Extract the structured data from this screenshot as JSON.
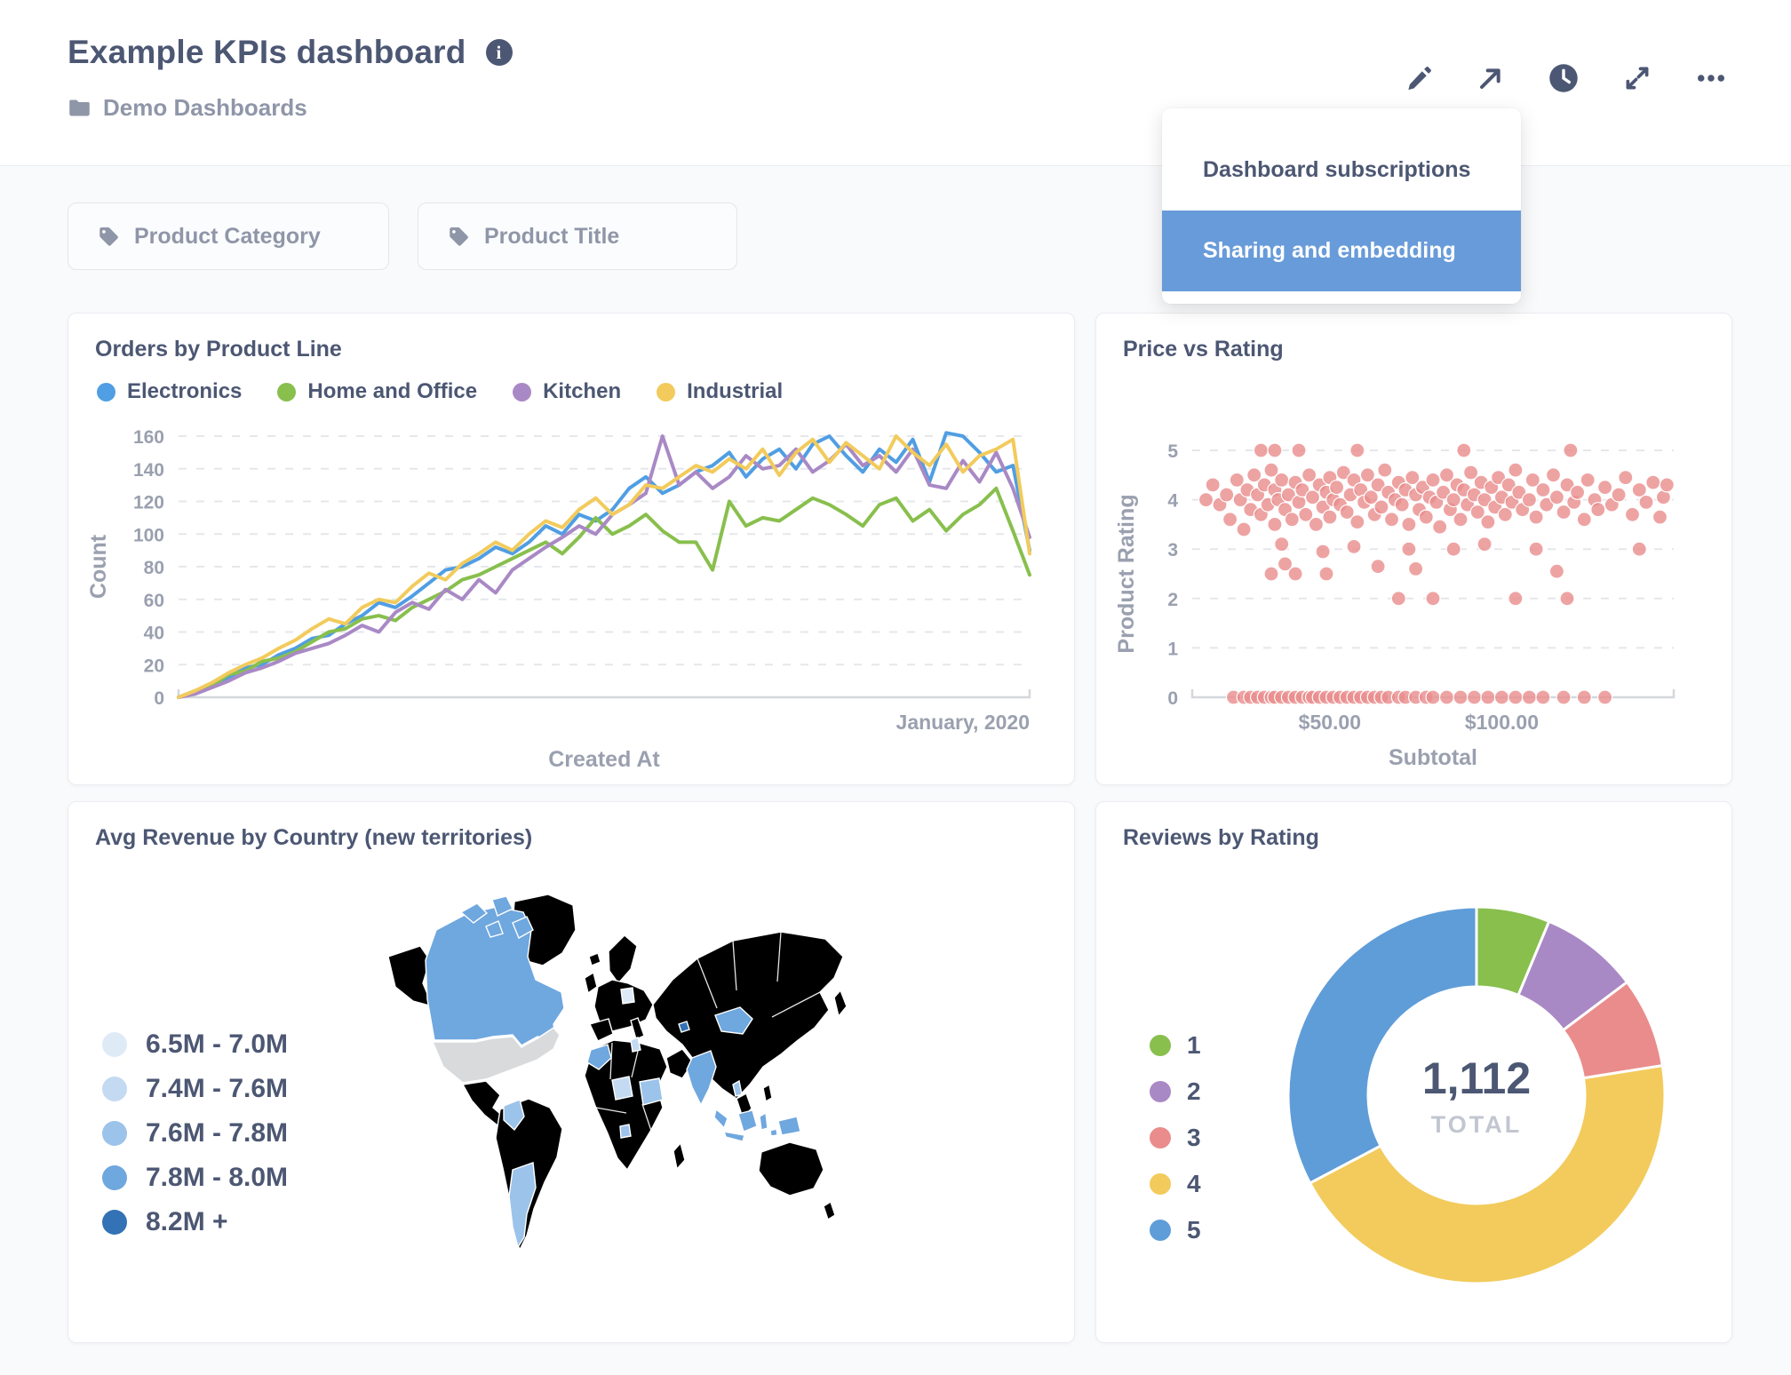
{
  "header": {
    "title": "Example KPIs dashboard",
    "breadcrumb": "Demo Dashboards"
  },
  "menu": {
    "active_bg": "#689BD9",
    "items": [
      {
        "label": "Dashboard subscriptions",
        "active": false
      },
      {
        "label": "Sharing and embedding",
        "active": true
      }
    ]
  },
  "filters": [
    {
      "label": "Product Category"
    },
    {
      "label": "Product Title"
    }
  ],
  "chart_data": [
    {
      "type": "line",
      "title": "Orders by Product Line",
      "xlabel": "Created At",
      "ylabel": "Count",
      "x_end_label": "January, 2020",
      "ylim": [
        0,
        160
      ],
      "yticks": [
        0,
        20,
        40,
        60,
        80,
        100,
        120,
        140,
        160
      ],
      "grid": "dashed-horizontal",
      "legend_position": "top",
      "series": [
        {
          "name": "Electronics",
          "color": "#509EE3",
          "values": [
            0,
            3,
            8,
            12,
            18,
            20,
            26,
            30,
            36,
            38,
            45,
            50,
            58,
            55,
            62,
            70,
            78,
            80,
            85,
            92,
            88,
            95,
            105,
            100,
            112,
            108,
            115,
            128,
            135,
            125,
            130,
            138,
            142,
            150,
            135,
            146,
            152,
            140,
            155,
            160,
            148,
            138,
            152,
            144,
            158,
            132,
            162,
            160,
            150,
            138,
            142,
            90
          ]
        },
        {
          "name": "Home and Office",
          "color": "#88BF4D",
          "values": [
            0,
            4,
            7,
            14,
            16,
            22,
            24,
            28,
            34,
            40,
            42,
            48,
            50,
            47,
            55,
            60,
            65,
            72,
            75,
            80,
            85,
            90,
            95,
            88,
            98,
            110,
            100,
            105,
            112,
            102,
            95,
            95,
            78,
            120,
            105,
            110,
            108,
            115,
            122,
            118,
            112,
            105,
            118,
            122,
            108,
            115,
            102,
            112,
            118,
            128,
            102,
            75
          ]
        },
        {
          "name": "Kitchen",
          "color": "#A989C5",
          "values": [
            0,
            2,
            6,
            10,
            15,
            18,
            22,
            27,
            30,
            33,
            38,
            44,
            40,
            52,
            58,
            54,
            66,
            60,
            72,
            64,
            78,
            85,
            92,
            98,
            105,
            100,
            112,
            118,
            125,
            160,
            130,
            138,
            128,
            135,
            148,
            140,
            142,
            152,
            138,
            145,
            155,
            142,
            148,
            138,
            152,
            130,
            128,
            145,
            132,
            150,
            128,
            98
          ]
        },
        {
          "name": "Industrial",
          "color": "#F2CB5C",
          "values": [
            0,
            4,
            9,
            15,
            20,
            24,
            30,
            35,
            42,
            48,
            45,
            55,
            60,
            58,
            68,
            76,
            72,
            82,
            88,
            95,
            90,
            100,
            108,
            104,
            115,
            122,
            112,
            118,
            130,
            128,
            135,
            142,
            138,
            146,
            140,
            152,
            136,
            150,
            158,
            144,
            156,
            148,
            140,
            160,
            150,
            142,
            155,
            138,
            148,
            152,
            158,
            88
          ]
        }
      ]
    },
    {
      "type": "scatter",
      "title": "Price vs Rating",
      "xlabel": "Subtotal",
      "ylabel": "Product Rating",
      "xlim": [
        10,
        150
      ],
      "ylim": [
        0,
        5
      ],
      "yticks": [
        0,
        1,
        2,
        3,
        4,
        5
      ],
      "xticks": [
        {
          "value": 50,
          "label": "$50.00"
        },
        {
          "value": 100,
          "label": "$100.00"
        }
      ],
      "color": "#EA8C8C",
      "points": [
        [
          14,
          4.0
        ],
        [
          16,
          4.3
        ],
        [
          18,
          3.9
        ],
        [
          20,
          4.1
        ],
        [
          21,
          3.6
        ],
        [
          23,
          4.4
        ],
        [
          24,
          4.0
        ],
        [
          25,
          3.4
        ],
        [
          26,
          4.2
        ],
        [
          27,
          3.8
        ],
        [
          28,
          4.5
        ],
        [
          29,
          4.1
        ],
        [
          30,
          3.7
        ],
        [
          30,
          5.0
        ],
        [
          31,
          4.3
        ],
        [
          32,
          3.9
        ],
        [
          33,
          4.6
        ],
        [
          33,
          2.5
        ],
        [
          34,
          4.2
        ],
        [
          34,
          3.5
        ],
        [
          34,
          5.0
        ],
        [
          35,
          4.0
        ],
        [
          36,
          4.4
        ],
        [
          36,
          3.1
        ],
        [
          37,
          3.8
        ],
        [
          37,
          2.7
        ],
        [
          38,
          4.1
        ],
        [
          39,
          3.6
        ],
        [
          40,
          4.35
        ],
        [
          40,
          2.5
        ],
        [
          41,
          3.95
        ],
        [
          41,
          5.0
        ],
        [
          42,
          4.2
        ],
        [
          43,
          3.7
        ],
        [
          44,
          4.5
        ],
        [
          45,
          4.05
        ],
        [
          46,
          3.5
        ],
        [
          47,
          4.3
        ],
        [
          48,
          3.85
        ],
        [
          48,
          2.95
        ],
        [
          49,
          4.15
        ],
        [
          49,
          2.5
        ],
        [
          50,
          4.45
        ],
        [
          50,
          3.65
        ],
        [
          51,
          4.0
        ],
        [
          52,
          4.25
        ],
        [
          53,
          3.9
        ],
        [
          54,
          4.55
        ],
        [
          55,
          3.75
        ],
        [
          56,
          4.1
        ],
        [
          57,
          4.4
        ],
        [
          57,
          3.05
        ],
        [
          58,
          3.55
        ],
        [
          58,
          5.0
        ],
        [
          59,
          4.2
        ],
        [
          60,
          3.95
        ],
        [
          61,
          4.5
        ],
        [
          62,
          4.05
        ],
        [
          63,
          3.7
        ],
        [
          64,
          4.3
        ],
        [
          64,
          2.65
        ],
        [
          65,
          3.85
        ],
        [
          66,
          4.6
        ],
        [
          67,
          4.15
        ],
        [
          68,
          3.6
        ],
        [
          69,
          4.0
        ],
        [
          70,
          4.35
        ],
        [
          70,
          2.0
        ],
        [
          71,
          3.9
        ],
        [
          72,
          4.2
        ],
        [
          73,
          3.5
        ],
        [
          73,
          3.0
        ],
        [
          74,
          4.45
        ],
        [
          75,
          4.1
        ],
        [
          75,
          2.6
        ],
        [
          76,
          3.8
        ],
        [
          77,
          4.25
        ],
        [
          78,
          3.65
        ],
        [
          79,
          4.05
        ],
        [
          80,
          4.4
        ],
        [
          80,
          2.0
        ],
        [
          81,
          3.95
        ],
        [
          82,
          3.45
        ],
        [
          83,
          4.15
        ],
        [
          84,
          4.5
        ],
        [
          85,
          3.8
        ],
        [
          86,
          4.0
        ],
        [
          86,
          3.0
        ],
        [
          87,
          4.3
        ],
        [
          88,
          3.6
        ],
        [
          89,
          4.2
        ],
        [
          89,
          5.0
        ],
        [
          90,
          3.9
        ],
        [
          91,
          4.55
        ],
        [
          92,
          4.1
        ],
        [
          93,
          3.75
        ],
        [
          94,
          4.35
        ],
        [
          95,
          4.0
        ],
        [
          95,
          3.1
        ],
        [
          96,
          3.55
        ],
        [
          97,
          4.25
        ],
        [
          98,
          3.85
        ],
        [
          99,
          4.45
        ],
        [
          100,
          4.05
        ],
        [
          101,
          3.7
        ],
        [
          102,
          4.3
        ],
        [
          103,
          3.95
        ],
        [
          104,
          4.6
        ],
        [
          104,
          2.0
        ],
        [
          105,
          4.15
        ],
        [
          106,
          3.8
        ],
        [
          108,
          4.0
        ],
        [
          109,
          4.4
        ],
        [
          110,
          3.65
        ],
        [
          110,
          3.0
        ],
        [
          112,
          4.2
        ],
        [
          113,
          3.9
        ],
        [
          115,
          4.5
        ],
        [
          116,
          4.05
        ],
        [
          116,
          2.55
        ],
        [
          118,
          3.75
        ],
        [
          119,
          4.3
        ],
        [
          119,
          2.0
        ],
        [
          120,
          5.0
        ],
        [
          121,
          3.95
        ],
        [
          122,
          4.15
        ],
        [
          124,
          3.6
        ],
        [
          125,
          4.4
        ],
        [
          127,
          4.0
        ],
        [
          128,
          3.8
        ],
        [
          130,
          4.25
        ],
        [
          132,
          3.9
        ],
        [
          134,
          4.1
        ],
        [
          136,
          4.45
        ],
        [
          138,
          3.7
        ],
        [
          140,
          4.2
        ],
        [
          140,
          3.0
        ],
        [
          142,
          3.95
        ],
        [
          144,
          4.35
        ],
        [
          146,
          3.65
        ],
        [
          147,
          4.05
        ],
        [
          148,
          4.3
        ],
        [
          22,
          0
        ],
        [
          25,
          0
        ],
        [
          27,
          0
        ],
        [
          29,
          0
        ],
        [
          31,
          0
        ],
        [
          33,
          0
        ],
        [
          34,
          0
        ],
        [
          36,
          0
        ],
        [
          38,
          0
        ],
        [
          40,
          0
        ],
        [
          42,
          0
        ],
        [
          44,
          0
        ],
        [
          45,
          0
        ],
        [
          47,
          0
        ],
        [
          49,
          0
        ],
        [
          51,
          0
        ],
        [
          53,
          0
        ],
        [
          55,
          0
        ],
        [
          57,
          0
        ],
        [
          59,
          0
        ],
        [
          61,
          0
        ],
        [
          63,
          0
        ],
        [
          65,
          0
        ],
        [
          67,
          0
        ],
        [
          70,
          0
        ],
        [
          72,
          0
        ],
        [
          75,
          0
        ],
        [
          78,
          0
        ],
        [
          80,
          0
        ],
        [
          84,
          0
        ],
        [
          88,
          0
        ],
        [
          92,
          0
        ],
        [
          96,
          0
        ],
        [
          100,
          0
        ],
        [
          104,
          0
        ],
        [
          108,
          0
        ],
        [
          112,
          0
        ],
        [
          118,
          0
        ],
        [
          124,
          0
        ],
        [
          130,
          0
        ]
      ]
    },
    {
      "type": "choropleth",
      "title": "Avg Revenue by Country (new territories)",
      "legend": [
        {
          "label": "6.5M - 7.0M",
          "color": "#DEEBF7"
        },
        {
          "label": "7.4M - 7.6M",
          "color": "#C4DAF2"
        },
        {
          "label": "7.6M - 7.8M",
          "color": "#9CC3EA"
        },
        {
          "label": "7.8M - 8.0M",
          "color": "#6FA7DF"
        },
        {
          "label": "8.2M +",
          "color": "#3272B5"
        }
      ],
      "land_color": "#CBCED0",
      "country_colors": {
        "usa": "#D8DADC",
        "canada": "#6FA7DF",
        "colombia": "#9CC3EA",
        "argentina": "#9CC3EA",
        "germany": "#DEEBF7",
        "morocco": "#6FA7DF",
        "tunisia": "#C4DAF2",
        "niger": "#C4DAF2",
        "sudan": "#9CC3EA",
        "gabon": "#9CC3EA",
        "azerbaijan": "#3272B5",
        "mongolia": "#6FA7DF",
        "india": "#6FA7DF",
        "laos": "#9CC3EA",
        "indonesia": "#6FA7DF",
        "new_guinea": "#6FA7DF"
      }
    },
    {
      "type": "pie",
      "title": "Reviews by Rating",
      "center": {
        "value": "1,112",
        "label": "TOTAL"
      },
      "slices": [
        {
          "label": "1",
          "value": 70,
          "color": "#88BF4D"
        },
        {
          "label": "2",
          "value": 94,
          "color": "#A989C5"
        },
        {
          "label": "3",
          "value": 86,
          "color": "#EA8C8C"
        },
        {
          "label": "4",
          "value": 498,
          "color": "#F2CB5C"
        },
        {
          "label": "5",
          "value": 364,
          "color": "#5F9DD8"
        }
      ]
    }
  ]
}
